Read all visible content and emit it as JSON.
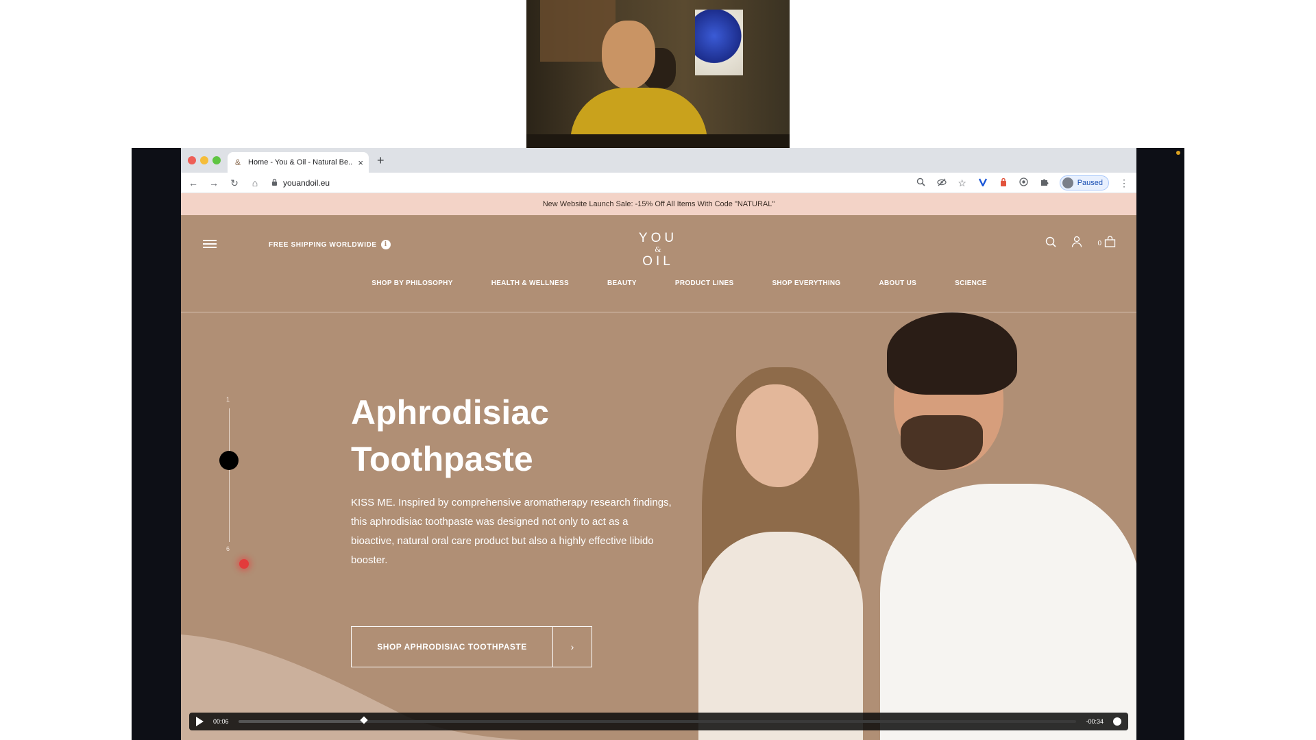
{
  "browser": {
    "tab_title": "Home - You & Oil - Natural Be...",
    "tab_favicon": "&",
    "tab_close": "×",
    "new_tab": "+",
    "url": "youandoil.eu",
    "profile_status": "Paused",
    "nav_back": "←",
    "nav_forward": "→",
    "nav_reload": "↻",
    "nav_home": "⌂",
    "zoom_icon": "🔍︎",
    "star_icon": "☆",
    "menu_icon": "⋮"
  },
  "site": {
    "promo_bar": "New Website Launch Sale: -15% Off All Items With Code \"NATURAL\"",
    "free_shipping": "FREE SHIPPING WORLDWIDE",
    "info_glyph": "i",
    "logo_top": "YOU",
    "logo_amp": "&",
    "logo_bottom": "OIL",
    "cart_count": "0",
    "nav": [
      "SHOP BY PHILOSOPHY",
      "HEALTH & WELLNESS",
      "BEAUTY",
      "PRODUCT LINES",
      "SHOP EVERYTHING",
      "ABOUT US",
      "SCIENCE"
    ],
    "slider_top": "1",
    "slider_bottom": "6",
    "hero_title": "Aphrodisiac Toothpaste",
    "hero_text": "KISS ME. Inspired by comprehensive aromatherapy research findings, this aphrodisiac toothpaste was designed not only to act as a bioactive, natural oral care product but also a highly effective libido booster.",
    "cta_label": "SHOP APHRODISIAC TOOTHPASTE",
    "cta_arrow": "›"
  },
  "video": {
    "elapsed": "00:06",
    "remaining": "-00:34",
    "progress_fraction": 0.15
  },
  "colors": {
    "site_bg": "#b08f75",
    "promo_bg": "#f3d3c7",
    "frame_bg": "#0d0f16"
  }
}
